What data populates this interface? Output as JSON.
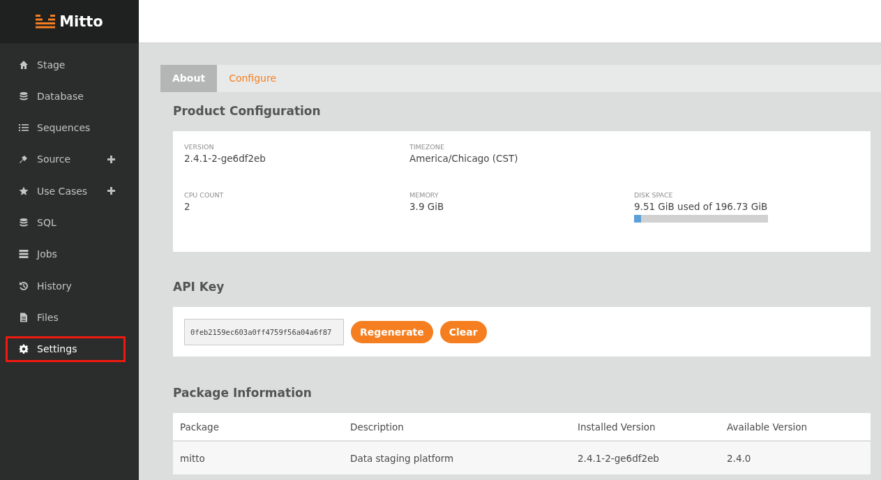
{
  "brand": "Mitto",
  "sidebar": {
    "items": [
      {
        "label": "Stage",
        "selected": false,
        "expandable": false
      },
      {
        "label": "Database",
        "selected": false,
        "expandable": false
      },
      {
        "label": "Sequences",
        "selected": false,
        "expandable": false
      },
      {
        "label": "Source",
        "selected": false,
        "expandable": true
      },
      {
        "label": "Use Cases",
        "selected": false,
        "expandable": true
      },
      {
        "label": "SQL",
        "selected": false,
        "expandable": false
      },
      {
        "label": "Jobs",
        "selected": false,
        "expandable": false
      },
      {
        "label": "History",
        "selected": false,
        "expandable": false
      },
      {
        "label": "Files",
        "selected": false,
        "expandable": false
      },
      {
        "label": "Settings",
        "selected": true,
        "expandable": false
      }
    ]
  },
  "tabs": [
    {
      "label": "About",
      "selected": true
    },
    {
      "label": "Configure",
      "selected": false
    }
  ],
  "product_configuration": {
    "title": "Product Configuration",
    "rows": [
      [
        {
          "label": "VERSION",
          "value": "2.4.1-2-ge6df2eb"
        },
        {
          "label": "TIMEZONE",
          "value": "America/Chicago (CST)"
        }
      ],
      [
        {
          "label": "CPU COUNT",
          "value": "2"
        },
        {
          "label": "MEMORY",
          "value": "3.9 GiB"
        },
        {
          "label": "DISK SPACE",
          "value": "9.51 GiB used of 196.73 GiB",
          "level": 0.05
        }
      ]
    ]
  },
  "api_key": {
    "title": "API Key",
    "value": "0feb2159ec603a0ff4759f56a04a6f87",
    "buttons": [
      "Regenerate",
      "Clear"
    ]
  },
  "package_information": {
    "title": "Package Information",
    "columns": [
      "Package",
      "Description",
      "Installed Version",
      "Available Version"
    ],
    "rows": [
      [
        "mitto",
        "Data staging platform",
        "2.4.1-2-ge6df2eb",
        "2.4.0"
      ]
    ]
  }
}
